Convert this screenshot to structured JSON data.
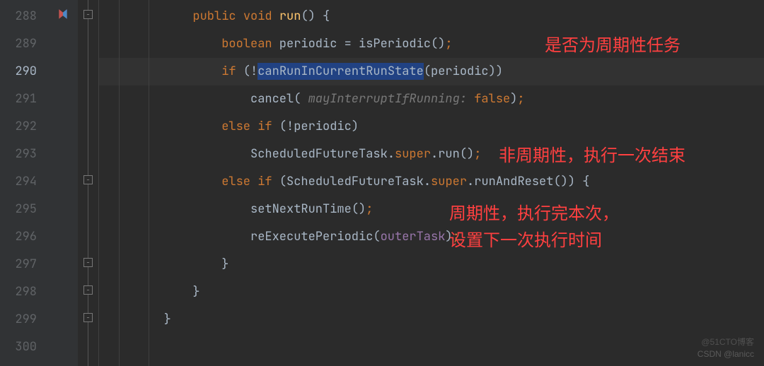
{
  "gutter": {
    "lines": [
      "288",
      "289",
      "290",
      "291",
      "292",
      "293",
      "294",
      "295",
      "296",
      "297",
      "298",
      "299",
      "300"
    ],
    "current_index": 2
  },
  "code": {
    "l288": {
      "indent": "            ",
      "kw_public": "public",
      "kw_void": "void",
      "method": "run",
      "paren": "()",
      "brace": " {"
    },
    "l289": {
      "indent": "                ",
      "kw_boolean": "boolean",
      "var": " periodic ",
      "eq": "=",
      "call": " isPeriodic()",
      "semi": ";"
    },
    "l290": {
      "indent": "                ",
      "kw_if": "if",
      "open": " (!",
      "call": "canRunInCurrentRunState",
      "args_open": "(",
      "arg": "periodic",
      "args_close": "))"
    },
    "l291": {
      "indent": "                    ",
      "call": "cancel",
      "open": "(",
      "hint": " mayInterruptIfRunning: ",
      "val": "false",
      "close": ")",
      "semi": ";"
    },
    "l292": {
      "indent": "                ",
      "kw_else": "else",
      "kw_if": " if",
      "open": " (!",
      "arg": "periodic",
      "close": ")"
    },
    "l293": {
      "indent": "                    ",
      "cls": "ScheduledFutureTask",
      "dot": ".",
      "sup": "super",
      "dot2": ".",
      "call": "run",
      "paren": "()",
      "semi": ";"
    },
    "l294": {
      "indent": "                ",
      "kw_else": "else",
      "kw_if": " if",
      "open": " (",
      "cls": "ScheduledFutureTask",
      "dot": ".",
      "sup": "super",
      "dot2": ".",
      "call": "runAndReset",
      "paren": "()",
      "close": ")",
      "brace": " {"
    },
    "l295": {
      "indent": "                    ",
      "call": "setNextRunTime",
      "paren": "()",
      "semi": ";"
    },
    "l296": {
      "indent": "                    ",
      "call": "reExecutePeriodic",
      "open": "(",
      "arg": "outerTask",
      "close": ")",
      "semi": ";"
    },
    "l297": {
      "indent": "                ",
      "brace": "}"
    },
    "l298": {
      "indent": "            ",
      "brace": "}"
    },
    "l299": {
      "indent": "        ",
      "brace": "}"
    }
  },
  "annotations": {
    "a1": "是否为周期性任务",
    "a2": "非周期性，执行一次结束",
    "a3_line1": "周期性，执行完本次，",
    "a3_line2": "设置下一次执行时间"
  },
  "watermark": {
    "main": "CSDN @lanicc",
    "top": "@51CTO博客"
  }
}
